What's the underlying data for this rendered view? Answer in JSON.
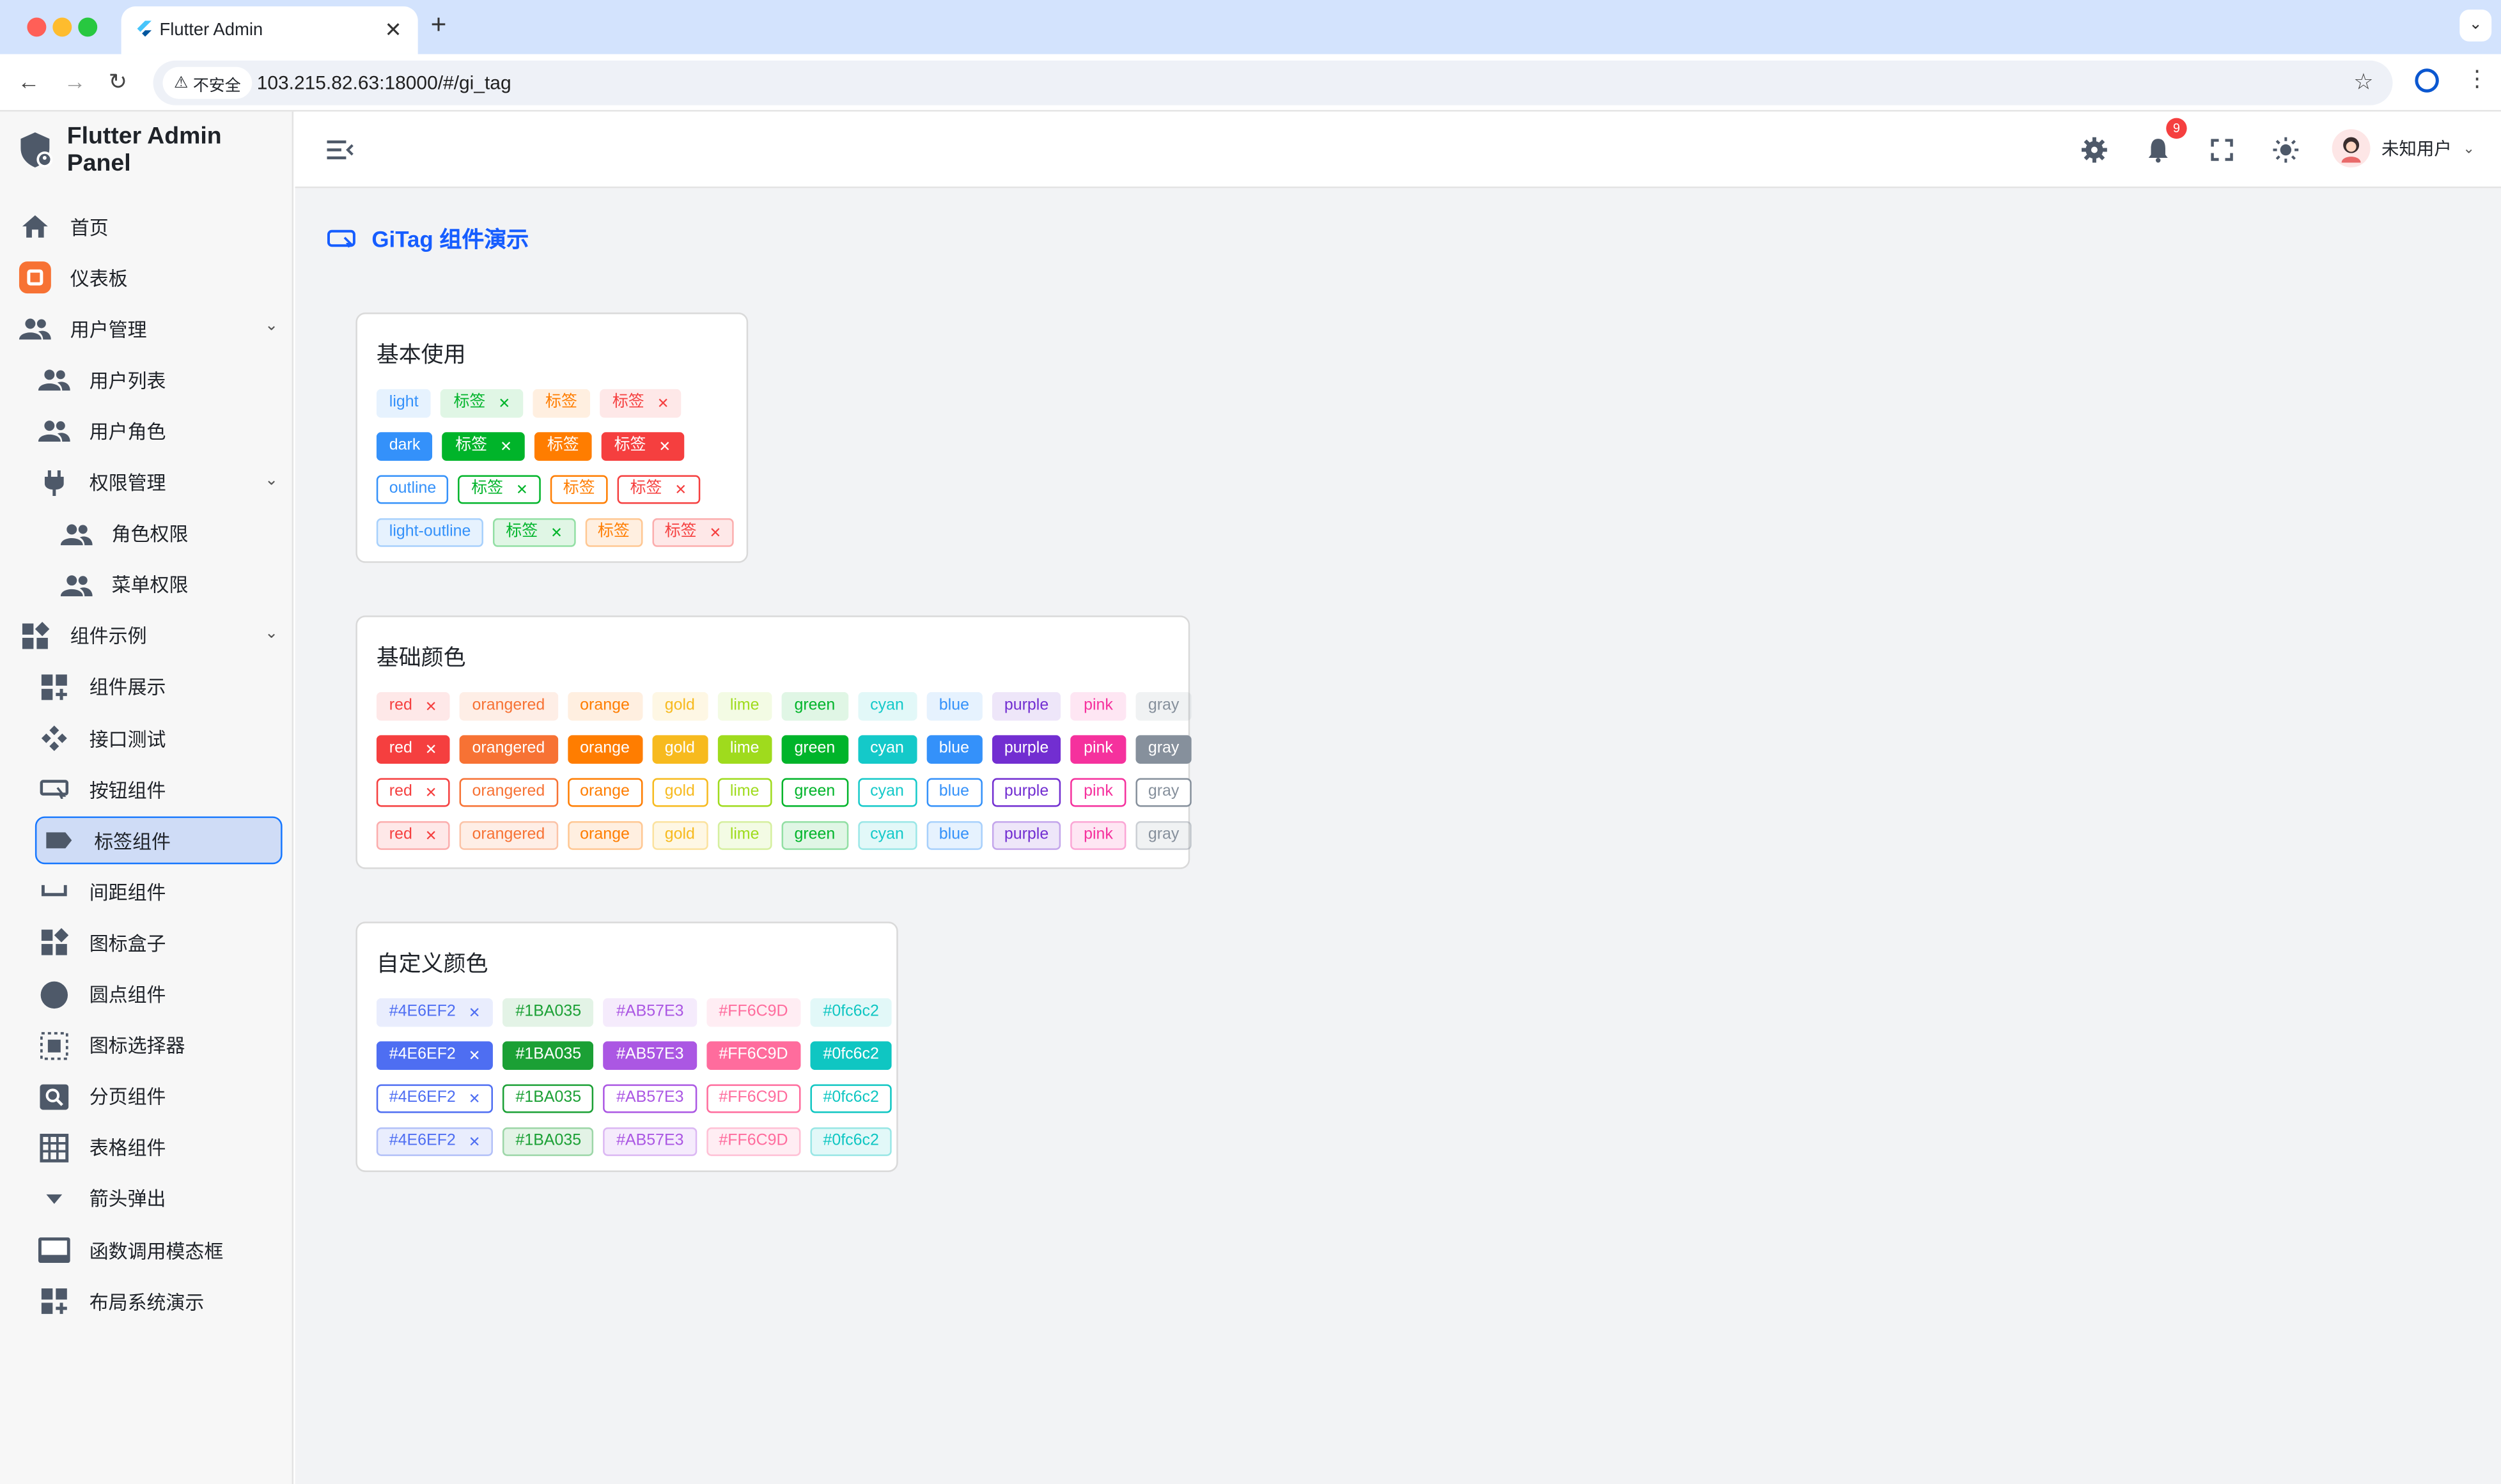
{
  "browser": {
    "tab_title": "Flutter Admin",
    "insecure_label": "不安全",
    "url": "103.215.82.63:18000/#/gi_tag"
  },
  "app": {
    "title": "Flutter Admin Panel"
  },
  "sidebar": {
    "items": [
      {
        "label": "首页",
        "icon": "home-icon"
      },
      {
        "label": "仪表板",
        "icon": "dashboard-icon"
      },
      {
        "label": "用户管理",
        "icon": "people-icon"
      },
      {
        "label": "用户列表",
        "icon": "people-icon"
      },
      {
        "label": "用户角色",
        "icon": "people-icon"
      },
      {
        "label": "权限管理",
        "icon": "plug-icon"
      },
      {
        "label": "角色权限",
        "icon": "people-icon"
      },
      {
        "label": "菜单权限",
        "icon": "people-icon"
      },
      {
        "label": "组件示例",
        "icon": "widgets-icon"
      },
      {
        "label": "组件展示",
        "icon": "grid-add-icon"
      },
      {
        "label": "接口测试",
        "icon": "api-icon"
      },
      {
        "label": "按钮组件",
        "icon": "button-icon"
      },
      {
        "label": "标签组件",
        "icon": "label-icon"
      },
      {
        "label": "间距组件",
        "icon": "space-icon"
      },
      {
        "label": "图标盒子",
        "icon": "widgets-icon"
      },
      {
        "label": "圆点组件",
        "icon": "circle-icon"
      },
      {
        "label": "图标选择器",
        "icon": "select-icon"
      },
      {
        "label": "分页组件",
        "icon": "pageview-icon"
      },
      {
        "label": "表格组件",
        "icon": "table-icon"
      },
      {
        "label": "箭头弹出",
        "icon": "arrow-down-icon"
      },
      {
        "label": "函数调用模态框",
        "icon": "modal-icon"
      },
      {
        "label": "布局系统演示",
        "icon": "grid-add-icon"
      }
    ]
  },
  "header": {
    "notification_count": "9",
    "user_name": "未知用户"
  },
  "page": {
    "title": "GiTag 组件演示"
  },
  "colors": {
    "accent": "#165dff",
    "active_bg": "#cfdcf6"
  },
  "cards": {
    "basic": {
      "title": "基本使用",
      "rows": [
        [
          {
            "t": "light",
            "x": false,
            "c": "blue"
          },
          {
            "t": "标签",
            "x": true,
            "c": "green"
          },
          {
            "t": "标签",
            "x": false,
            "c": "orange"
          },
          {
            "t": "标签",
            "x": true,
            "c": "red"
          }
        ],
        [
          {
            "t": "dark",
            "x": false,
            "c": "blue"
          },
          {
            "t": "标签",
            "x": true,
            "c": "green"
          },
          {
            "t": "标签",
            "x": false,
            "c": "orange"
          },
          {
            "t": "标签",
            "x": true,
            "c": "red"
          }
        ],
        [
          {
            "t": "outline",
            "x": false,
            "c": "blue"
          },
          {
            "t": "标签",
            "x": true,
            "c": "green"
          },
          {
            "t": "标签",
            "x": false,
            "c": "orange"
          },
          {
            "t": "标签",
            "x": true,
            "c": "red"
          }
        ],
        [
          {
            "t": "light-outline",
            "x": false,
            "c": "blue"
          },
          {
            "t": "标签",
            "x": true,
            "c": "green"
          },
          {
            "t": "标签",
            "x": false,
            "c": "orange"
          },
          {
            "t": "标签",
            "x": true,
            "c": "red"
          }
        ]
      ]
    },
    "base": {
      "title": "基础颜色",
      "tags": [
        "red",
        "orangered",
        "orange",
        "gold",
        "lime",
        "green",
        "cyan",
        "blue",
        "purple",
        "pink",
        "gray"
      ]
    },
    "custom": {
      "title": "自定义颜色",
      "tags": [
        "#4E6EF2",
        "#1BA035",
        "#AB57E3",
        "#FF6C9D",
        "#0fc6c2"
      ]
    }
  },
  "palette": {
    "red": "#f53f3f",
    "orangered": "#f77234",
    "orange": "#ff7d00",
    "gold": "#f7ba1e",
    "lime": "#9fdb1d",
    "green": "#00b42a",
    "cyan": "#14c9c9",
    "blue": "#3491fa",
    "purple": "#722ed1",
    "pink": "#f5319d",
    "gray": "#86909c"
  }
}
